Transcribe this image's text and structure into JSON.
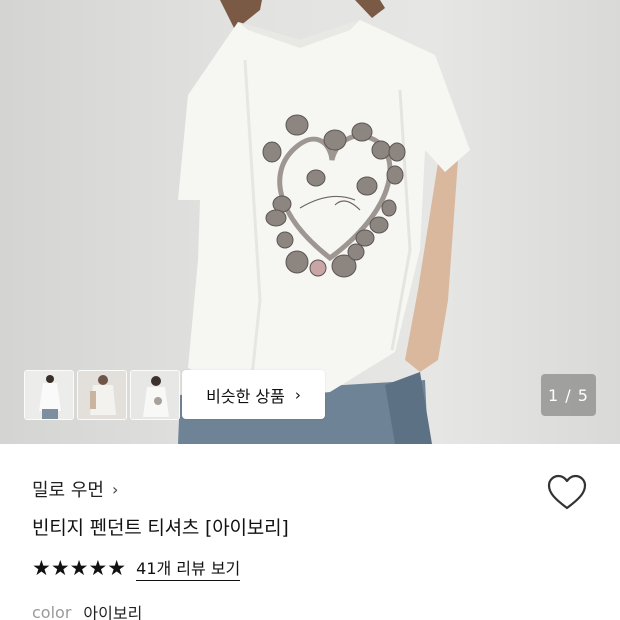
{
  "gallery": {
    "similar_button_label": "비슷한 상품",
    "similar_button_chevron": "›",
    "page_counter": "1 / 5",
    "thumbnails": [
      "thumb-1",
      "thumb-2",
      "thumb-3"
    ]
  },
  "product": {
    "brand": "밀로 우먼",
    "brand_chevron": "›",
    "title": "빈티지 펜던트 티셔츠 [아이보리]",
    "rating_stars": "★★★★★",
    "review_link": "41개 리뷰 보기",
    "option_label": "color",
    "option_value": "아이보리"
  },
  "colors": {
    "accent": "#111111",
    "muted": "#9a9a9a",
    "counter_bg": "#6e6e6e"
  }
}
